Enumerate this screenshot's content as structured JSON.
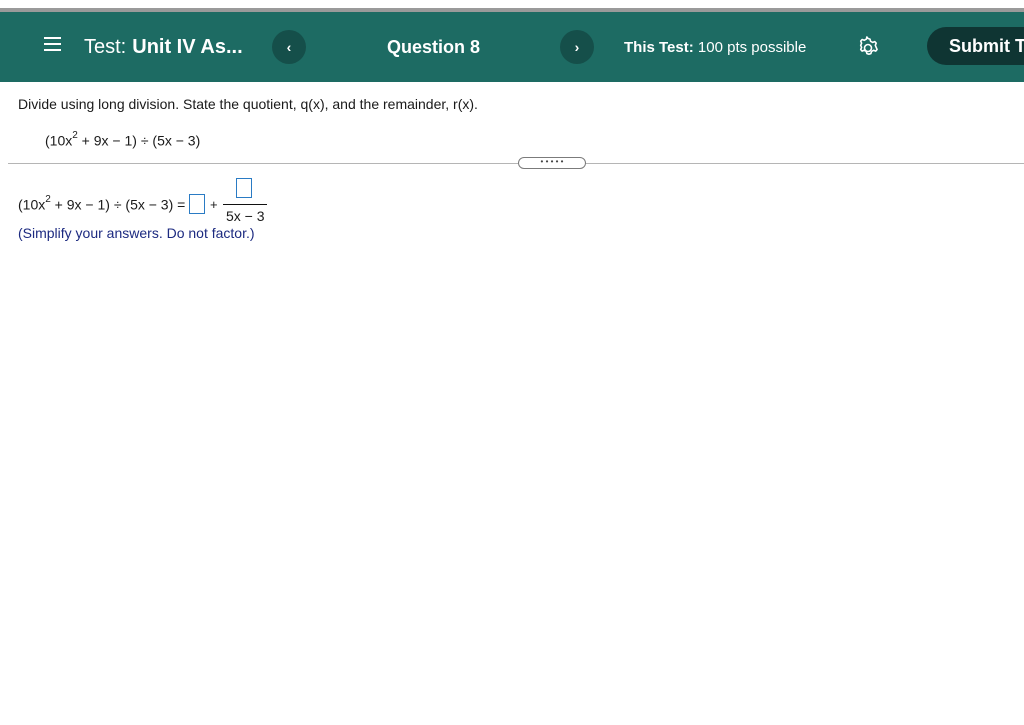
{
  "header": {
    "test_label": "Test:",
    "test_name": "Unit IV As...",
    "question": "Question 8",
    "this_test_label": "This Test:",
    "this_test_value": "100 pts possible",
    "submit_label": "Submit T"
  },
  "problem": {
    "prompt": "Divide using long division. State the quotient, q(x), and the remainder, r(x).",
    "expr_part1": "(10x",
    "expr_exp": "2",
    "expr_part2": " + 9x − 1) ÷ (5x − 3)"
  },
  "answer": {
    "lhs_part1": "(10x",
    "lhs_exp": "2",
    "lhs_part2": " + 9x − 1) ÷ (5x − 3) =",
    "plus": "+",
    "denominator": "5x − 3",
    "instruction": "(Simplify your answers. Do not factor.)"
  },
  "handle_dots": "• • • • •",
  "colors": {
    "header_bg": "#1d6b63",
    "submit_bg": "#0f3533",
    "answer_box": "#2a7bc4",
    "instruction_text": "#1c2a80"
  },
  "icons": [
    "menu-icon",
    "chevron-left-icon",
    "chevron-right-icon",
    "gear-icon"
  ]
}
